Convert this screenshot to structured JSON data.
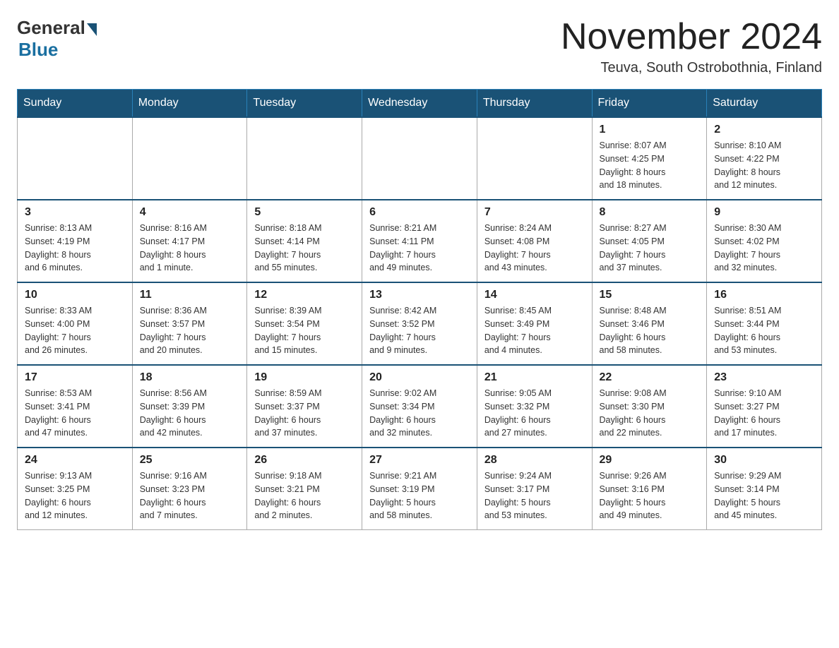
{
  "header": {
    "logo_general": "General",
    "logo_blue": "Blue",
    "month_title": "November 2024",
    "location": "Teuva, South Ostrobothnia, Finland"
  },
  "weekdays": [
    "Sunday",
    "Monday",
    "Tuesday",
    "Wednesday",
    "Thursday",
    "Friday",
    "Saturday"
  ],
  "weeks": [
    [
      {
        "day": "",
        "info": ""
      },
      {
        "day": "",
        "info": ""
      },
      {
        "day": "",
        "info": ""
      },
      {
        "day": "",
        "info": ""
      },
      {
        "day": "",
        "info": ""
      },
      {
        "day": "1",
        "info": "Sunrise: 8:07 AM\nSunset: 4:25 PM\nDaylight: 8 hours\nand 18 minutes."
      },
      {
        "day": "2",
        "info": "Sunrise: 8:10 AM\nSunset: 4:22 PM\nDaylight: 8 hours\nand 12 minutes."
      }
    ],
    [
      {
        "day": "3",
        "info": "Sunrise: 8:13 AM\nSunset: 4:19 PM\nDaylight: 8 hours\nand 6 minutes."
      },
      {
        "day": "4",
        "info": "Sunrise: 8:16 AM\nSunset: 4:17 PM\nDaylight: 8 hours\nand 1 minute."
      },
      {
        "day": "5",
        "info": "Sunrise: 8:18 AM\nSunset: 4:14 PM\nDaylight: 7 hours\nand 55 minutes."
      },
      {
        "day": "6",
        "info": "Sunrise: 8:21 AM\nSunset: 4:11 PM\nDaylight: 7 hours\nand 49 minutes."
      },
      {
        "day": "7",
        "info": "Sunrise: 8:24 AM\nSunset: 4:08 PM\nDaylight: 7 hours\nand 43 minutes."
      },
      {
        "day": "8",
        "info": "Sunrise: 8:27 AM\nSunset: 4:05 PM\nDaylight: 7 hours\nand 37 minutes."
      },
      {
        "day": "9",
        "info": "Sunrise: 8:30 AM\nSunset: 4:02 PM\nDaylight: 7 hours\nand 32 minutes."
      }
    ],
    [
      {
        "day": "10",
        "info": "Sunrise: 8:33 AM\nSunset: 4:00 PM\nDaylight: 7 hours\nand 26 minutes."
      },
      {
        "day": "11",
        "info": "Sunrise: 8:36 AM\nSunset: 3:57 PM\nDaylight: 7 hours\nand 20 minutes."
      },
      {
        "day": "12",
        "info": "Sunrise: 8:39 AM\nSunset: 3:54 PM\nDaylight: 7 hours\nand 15 minutes."
      },
      {
        "day": "13",
        "info": "Sunrise: 8:42 AM\nSunset: 3:52 PM\nDaylight: 7 hours\nand 9 minutes."
      },
      {
        "day": "14",
        "info": "Sunrise: 8:45 AM\nSunset: 3:49 PM\nDaylight: 7 hours\nand 4 minutes."
      },
      {
        "day": "15",
        "info": "Sunrise: 8:48 AM\nSunset: 3:46 PM\nDaylight: 6 hours\nand 58 minutes."
      },
      {
        "day": "16",
        "info": "Sunrise: 8:51 AM\nSunset: 3:44 PM\nDaylight: 6 hours\nand 53 minutes."
      }
    ],
    [
      {
        "day": "17",
        "info": "Sunrise: 8:53 AM\nSunset: 3:41 PM\nDaylight: 6 hours\nand 47 minutes."
      },
      {
        "day": "18",
        "info": "Sunrise: 8:56 AM\nSunset: 3:39 PM\nDaylight: 6 hours\nand 42 minutes."
      },
      {
        "day": "19",
        "info": "Sunrise: 8:59 AM\nSunset: 3:37 PM\nDaylight: 6 hours\nand 37 minutes."
      },
      {
        "day": "20",
        "info": "Sunrise: 9:02 AM\nSunset: 3:34 PM\nDaylight: 6 hours\nand 32 minutes."
      },
      {
        "day": "21",
        "info": "Sunrise: 9:05 AM\nSunset: 3:32 PM\nDaylight: 6 hours\nand 27 minutes."
      },
      {
        "day": "22",
        "info": "Sunrise: 9:08 AM\nSunset: 3:30 PM\nDaylight: 6 hours\nand 22 minutes."
      },
      {
        "day": "23",
        "info": "Sunrise: 9:10 AM\nSunset: 3:27 PM\nDaylight: 6 hours\nand 17 minutes."
      }
    ],
    [
      {
        "day": "24",
        "info": "Sunrise: 9:13 AM\nSunset: 3:25 PM\nDaylight: 6 hours\nand 12 minutes."
      },
      {
        "day": "25",
        "info": "Sunrise: 9:16 AM\nSunset: 3:23 PM\nDaylight: 6 hours\nand 7 minutes."
      },
      {
        "day": "26",
        "info": "Sunrise: 9:18 AM\nSunset: 3:21 PM\nDaylight: 6 hours\nand 2 minutes."
      },
      {
        "day": "27",
        "info": "Sunrise: 9:21 AM\nSunset: 3:19 PM\nDaylight: 5 hours\nand 58 minutes."
      },
      {
        "day": "28",
        "info": "Sunrise: 9:24 AM\nSunset: 3:17 PM\nDaylight: 5 hours\nand 53 minutes."
      },
      {
        "day": "29",
        "info": "Sunrise: 9:26 AM\nSunset: 3:16 PM\nDaylight: 5 hours\nand 49 minutes."
      },
      {
        "day": "30",
        "info": "Sunrise: 9:29 AM\nSunset: 3:14 PM\nDaylight: 5 hours\nand 45 minutes."
      }
    ]
  ]
}
